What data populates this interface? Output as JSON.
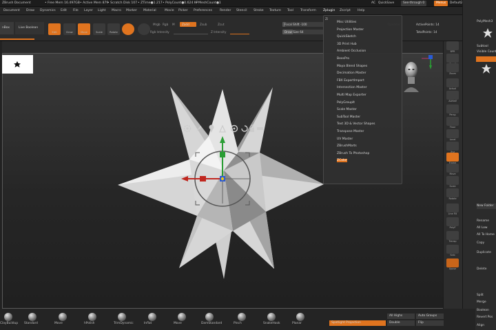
{
  "title_bar": {
    "app": "ZBrush Document",
    "free_mem": "• Free Mem 16.497GB",
    "active_mem": "• Active Mem 879",
    "scratch_disk": "• Scratch Disk 107",
    "ztime": "• ZTime●1.217",
    "poly_count": "• PolyCount●0.624 KP",
    "mesh_count": "• MeshCount●1",
    "ac": "AC",
    "quicksave": "QuickSave",
    "see_through": "See-through 0",
    "menus": "Menus",
    "default_script": "DefaultZScript"
  },
  "menus": [
    "Document",
    "Draw",
    "Dynamics",
    "Edit",
    "File",
    "Layer",
    "Light",
    "Macro",
    "Marker",
    "Material",
    "Movie",
    "Picker",
    "Preferences",
    "Render",
    "Stencil",
    "Stroke",
    "Texture",
    "Tool",
    "Transform",
    "Zplugin",
    "Zscript",
    "Help"
  ],
  "active_menu": "Zplugin",
  "toolbar": {
    "lightbox": "nBox",
    "live_boolean": "Live Boolean",
    "edit": "Edit",
    "draw": "Draw",
    "move": "Move",
    "scale": "Scale",
    "rotate": "Rotate",
    "mrgb": "Mrgb",
    "rgb": "Rgb",
    "m": "M",
    "zadd": "Zadd",
    "zsub": "Zsub",
    "zcut": "Zcut",
    "rgb_intensity": "Rgb Intensity",
    "z_intensity": "Z Intensity",
    "focal_shift": "Focal Shift -100",
    "draw_size": "Draw Size 64",
    "dynamic": "Dynamic",
    "active_points": "ActivePoints: 14",
    "total_points": "TotalPoints: 14"
  },
  "zplugin_menu": {
    "header": "Zplugin",
    "items": [
      "Misc Utilities",
      "Projection Master",
      "QuickSketch",
      "3D Print Hub",
      "Ambient Occlusion",
      "BeesPro",
      "Maya Blend Shapes",
      "Decimation Master",
      "FBX ExportImport",
      "Intersection Master",
      "Multi Map Exporter",
      "PolyGroupIt",
      "Scale Master",
      "SubTool Master",
      "Text 3D & Vector Shapes",
      "Transpose Master",
      "UV Master",
      "ZBrushMarts",
      "ZBrush To Photoshop",
      "ZColor"
    ],
    "highlighted": "ZColor"
  },
  "brushes": [
    "ClayBuildup",
    "Standard",
    "Move",
    "hPolish",
    "TrimDynamic",
    "Inflat",
    "Move",
    "DamStandard",
    "Pinch",
    "SnakeHook",
    "Planar"
  ],
  "bottom_buttons": {
    "spotlight_projection": "Spotlight Projection",
    "all_tags": "All Highs",
    "double": "Double",
    "auto_groups": "Auto Groups",
    "flip": "Flip"
  },
  "right_shelf": [
    "BPR",
    "Scroll",
    "Zoom",
    "Actual",
    "AAHalf",
    "Persp",
    "Floor",
    "Local",
    "Xyz",
    "Frame",
    "Move",
    "Scale",
    "Rotate",
    "Line Fill",
    "PolyF",
    "Transp",
    "Solo",
    "Xpose"
  ],
  "tray": {
    "title": "PolyMesh3",
    "subtool": "Subtool",
    "visible_count": "Visible Count 1",
    "new_folder": "New Folder",
    "items": [
      "Rename",
      "All Low",
      "All To Home",
      "Copy",
      "Duplicate",
      "Delete",
      "Split",
      "Merge",
      "Boolean",
      "Revert Pos",
      "Align"
    ]
  },
  "colors": {
    "accent": "#e0741f",
    "background": "#2a2a2a",
    "viewport_border": "#5a5a5a",
    "gizmo_x": "#c0271f",
    "gizmo_y": "#2a9d34",
    "gizmo_z": "#2a5ad6",
    "gizmo_center": "#e8c21a"
  }
}
